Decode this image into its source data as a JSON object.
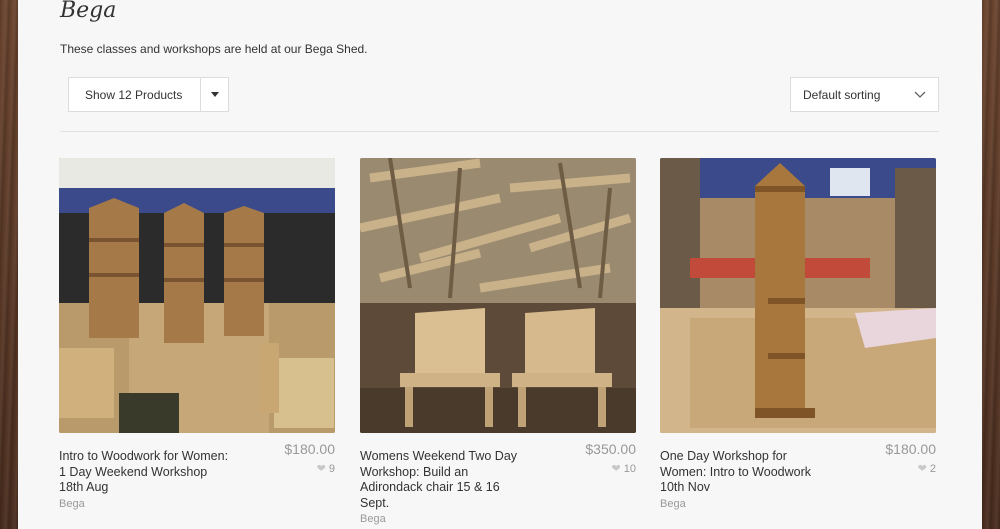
{
  "page": {
    "title": "Bega",
    "description": "These classes and workshops are held at our Bega Shed."
  },
  "toolbar": {
    "show_label": "Show 12 Products",
    "sort_label": "Default sorting"
  },
  "products": [
    {
      "name": "Intro to Woodwork for Women: 1 Day Weekend Workshop 18th Aug",
      "price": "$180.00",
      "likes": "9",
      "category": "Bega"
    },
    {
      "name": "Womens Weekend Two Day Workshop: Build an Adirondack chair 15 & 16 Sept.",
      "price": "$350.00",
      "likes": "10",
      "category": "Bega"
    },
    {
      "name": "One Day Workshop for Women: Intro to Woodwork 10th Nov",
      "price": "$180.00",
      "likes": "2",
      "category": "Bega"
    }
  ]
}
